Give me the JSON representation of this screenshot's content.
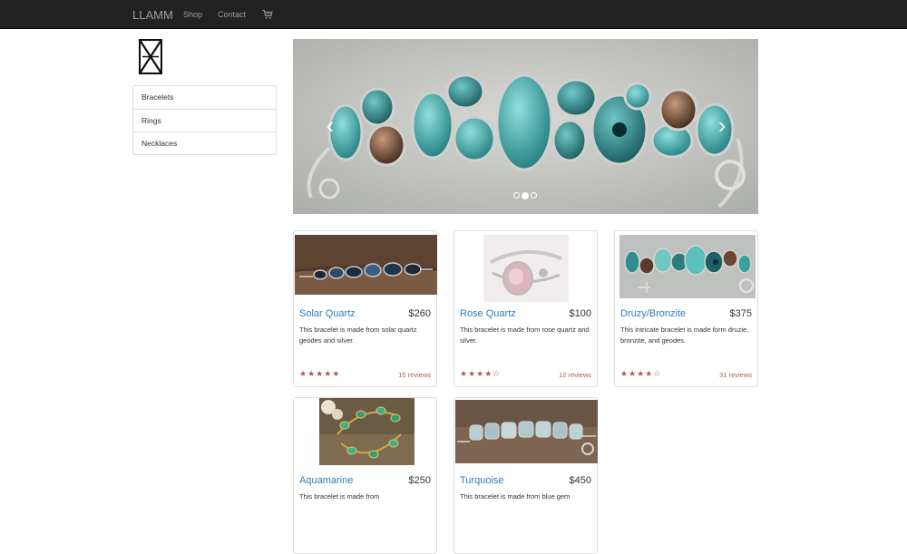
{
  "navbar": {
    "brand": "LLAMM",
    "links": [
      "Shop",
      "Contact"
    ],
    "cart_icon": "cart-icon"
  },
  "sidebar": {
    "categories": [
      "Bracelets",
      "Rings",
      "Necklaces"
    ]
  },
  "carousel": {
    "slide_count": 3,
    "active_slide": 1,
    "prev_label": "‹",
    "next_label": "›"
  },
  "products": [
    {
      "name": "Solar Quartz",
      "price": "$260",
      "description": "This bracelet is made from solar quartz geodes and silver.",
      "stars": "★★★★★",
      "reviews": "15 reviews"
    },
    {
      "name": "Rose Quartz",
      "price": "$100",
      "description": "This bracelet is made from rose quartz and silver.",
      "stars": "★★★★☆",
      "reviews": "12 reviews"
    },
    {
      "name": "Druzy/Bronzite",
      "price": "$375",
      "description": "This intricate bracelet is made form druzie, bronzite, and geodes.",
      "stars": "★★★★☆",
      "reviews": "31 reviews"
    },
    {
      "name": "Aquamarine",
      "price": "$250",
      "description": "This bracelet is made from",
      "stars": "",
      "reviews": ""
    },
    {
      "name": "Turquoise",
      "price": "$450",
      "description": "This bracelet is made from blue gem",
      "stars": "",
      "reviews": ""
    }
  ]
}
